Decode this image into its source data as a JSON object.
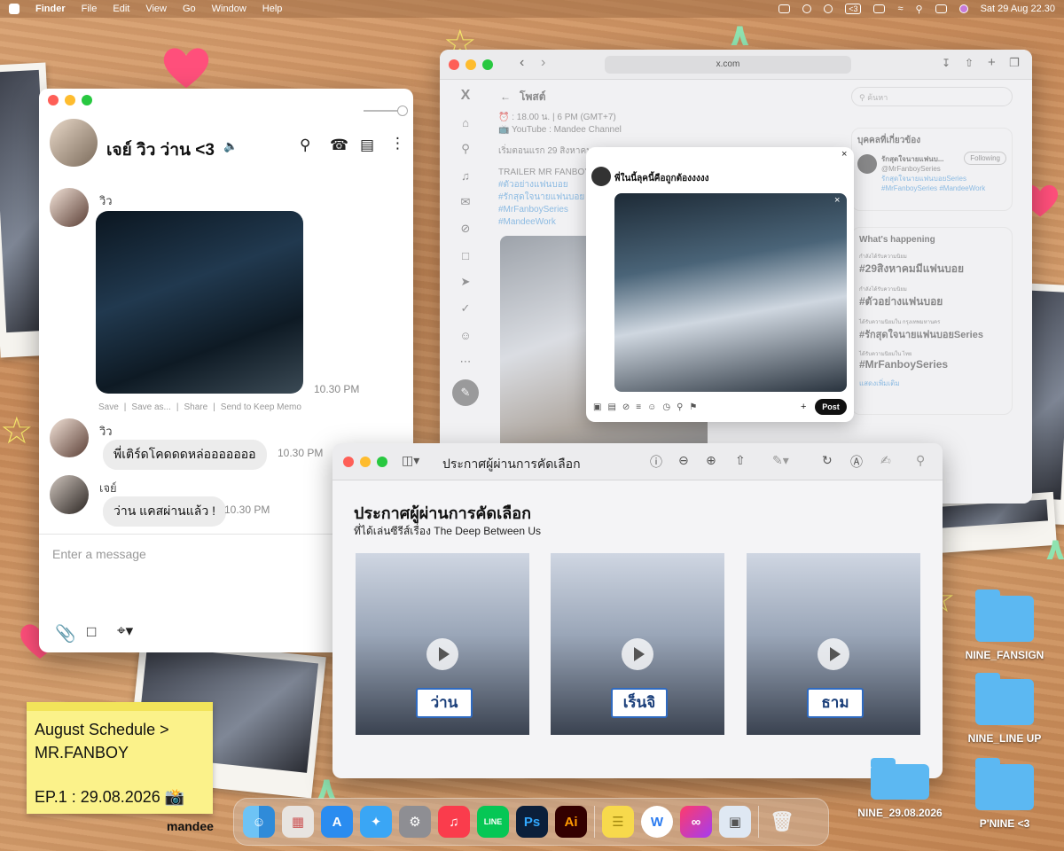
{
  "menubar": {
    "app": "Finder",
    "items": [
      "File",
      "Edit",
      "View",
      "Go",
      "Window",
      "Help"
    ],
    "battery_label": "<3",
    "datetime": "Sat 29 Aug 22.30"
  },
  "chat": {
    "title": "เจย์ วิว ว่าน <3",
    "messages": [
      {
        "sender": "วิว",
        "time": "10.30 PM"
      },
      {
        "sender": "วิว",
        "text": "พี่เติร์ดโคดดดหล่อออออออ",
        "time": "10.30 PM"
      },
      {
        "sender": "เจย์",
        "text": "ว่าน แคสผ่านแล้ว !",
        "time": "10.30 PM"
      }
    ],
    "photo_actions": [
      "Save",
      "Save as...",
      "Share",
      "Send to Keep Memo"
    ],
    "input_placeholder": "Enter a message"
  },
  "safari": {
    "url": "x.com",
    "page_title": "โพสต์",
    "post_lines": [
      "⏰ : 18.00 น. | 6 PM (GMT+7)",
      "📺 YouTube : Mandee Channel",
      "เริ่มตอนแรก 29 สิงหาคม",
      "TRAILER MR FANBOY",
      "#ตัวอย่างแฟนบอย",
      "#รักสุดใจนายแฟนบอย",
      "#MrFanboySeries",
      "#MandeeWork"
    ],
    "search_placeholder": "ค้นหา",
    "related_title": "บุคคลที่เกี่ยวข้อง",
    "related_name": "รักสุดใจนายแฟนบ...",
    "related_handle": "@MrFanboySeries",
    "related_bio": "รักสุดใจนายแฟนบอยSeries #MrFanboySeries #MandeeWork",
    "follow_label": "Following",
    "trends_title": "What's happening",
    "trends": [
      {
        "context": "กำลังได้รับความนิยม",
        "tag": "#29สิงหาคมมีแฟนบอย"
      },
      {
        "context": "กำลังได้รับความนิยม",
        "tag": "#ตัวอย่างแฟนบอย"
      },
      {
        "context": "ได้รับความนิยมใน กรุงเทพมหานคร",
        "tag": "#รักสุดใจนายแฟนบอยSeries"
      },
      {
        "context": "ได้รับความนิยมใน ไทย",
        "tag": "#MrFanboySeries"
      }
    ],
    "show_more": "แสดงเพิ่มเติม",
    "compose_text": "พี่ในนี้ลุคนี้คือถูกต้องงงงง",
    "post_button": "Post"
  },
  "preview": {
    "window_title": "ประกาศผู้ผ่านการคัดเลือก",
    "heading": "ประกาศผู้ผ่านการคัดเลือก",
    "subheading": "ที่ได้เล่นซีรีส์เรื่อง  The Deep Between Us",
    "candidates": [
      {
        "name": "ว่าน"
      },
      {
        "name": "เร็นจิ"
      },
      {
        "name": "ธาม"
      }
    ]
  },
  "note": {
    "line1": "August Schedule >",
    "line2": "MR.FANBOY",
    "line3": "EP.1 : 29.08.2026 📸"
  },
  "desktop": {
    "folders": [
      "NINE_FANSIGN",
      "NINE_LINE UP",
      "NINE_29.08.2026",
      "P'NINE <3"
    ],
    "watermark": "mandee"
  },
  "dock": {
    "apps": [
      "Finder",
      "Launchpad",
      "App Store",
      "Safari",
      "System Settings",
      "Music",
      "LINE",
      "Photoshop",
      "Illustrator",
      "Notes",
      "W",
      "Creative Cloud",
      "Preview",
      "Trash"
    ],
    "icon_text": {
      "line": "LINE",
      "ps": "Ps",
      "ai": "Ai",
      "w": "W"
    }
  },
  "colors": {
    "accent_blue": "#3a8fd6",
    "close": "#fe5f57",
    "minimize": "#febc2e",
    "zoom": "#28c840",
    "note_yellow": "#fbf28a",
    "folder_blue": "#5cb8f2"
  }
}
